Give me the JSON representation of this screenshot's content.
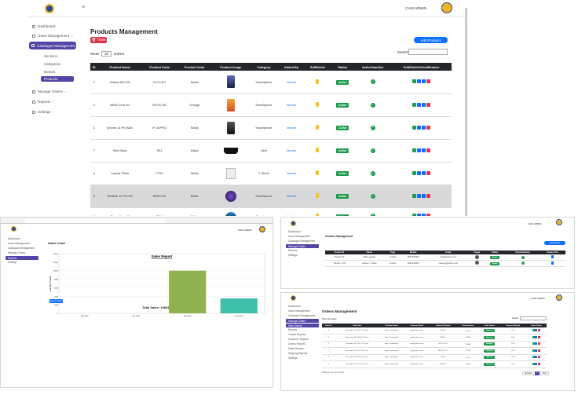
{
  "main": {
    "header": {
      "user_name": "CANI ADMIN",
      "menu_icon": "hamburger-icon"
    },
    "sidebar": {
      "items": [
        {
          "label": "Dashboard",
          "icon": "dashboard-icon"
        },
        {
          "label": "Users Management",
          "icon": "users-icon",
          "caret": "›"
        },
        {
          "label": "Catalogue Management",
          "icon": "catalogue-icon",
          "active": true
        }
      ],
      "sub_items": [
        "Sections",
        "Categories",
        "Brands",
        "Products"
      ],
      "bottom_items": [
        {
          "label": "Manage Orders",
          "caret": "›"
        },
        {
          "label": "Reports",
          "caret": "›"
        },
        {
          "label": "Settings",
          "caret": "›"
        }
      ]
    },
    "page_title": "Products Management",
    "trash_button": "🗑 Trash",
    "add_button": "Add Products",
    "show_label": "Show",
    "show_value": "10",
    "entries_label": "entries",
    "search_label": "Search:",
    "columns": [
      "ID",
      "Product Name",
      "Product Code",
      "Product Color",
      "Product Image",
      "Category",
      "Added By",
      "SoftDelete",
      "Status",
      "Active/Inactive",
      "Edit/Delete/View/Restore"
    ],
    "rows": [
      {
        "id": "1",
        "name": "Galaxy A32 5G",
        "code": "GLXY-5G",
        "color": "Black",
        "category": "Smartphone",
        "added_by": "Vendor",
        "status": "Active",
        "img": "phone-blue"
      },
      {
        "id": "2",
        "name": "Infinix Zero 5G",
        "code": "INFX0-5G",
        "color": "Orange",
        "category": "Smartphone",
        "added_by": "Vendor",
        "status": "Active",
        "img": "phone-orange"
      },
      {
        "id": "3",
        "name": "Iphone 14 Pro Max",
        "code": "IP-14PRO",
        "color": "Black",
        "category": "Smartphone",
        "added_by": "Vendor",
        "status": "Active",
        "img": "phone-black"
      },
      {
        "id": "7",
        "name": "Skirt Black",
        "code": "SK1",
        "color": "Black",
        "category": "Skirt",
        "added_by": "Vendor",
        "status": "Active",
        "img": "skirt"
      },
      {
        "id": "4",
        "name": "Casual TShirt",
        "code": "CTS1",
        "color": "White",
        "category": "T-Shirts",
        "added_by": "Vendor",
        "status": "Active",
        "img": "tshirt"
      },
      {
        "id": "8",
        "name": "Realme 10 Pro 5G",
        "code": "RM10-5G",
        "color": "Black",
        "category": "Smartphone",
        "added_by": "Vendor",
        "status": "Active",
        "img": "phone-round"
      },
      {
        "id": "9",
        "name": "Tecno Nova 5",
        "code": "TF-1",
        "color": "White",
        "category": "Smartphone",
        "added_by": "Vendor",
        "status": "Active",
        "img": "phone-blue2"
      }
    ]
  },
  "sales": {
    "header": {
      "user_name": "CANI ADMIN"
    },
    "sidebar": [
      "Dashboard",
      "Users Management",
      "Catalogue Management",
      "Manage Orders",
      "Reports",
      "Settings"
    ],
    "section_title": "Sales Chart",
    "export_button": "Export Chart",
    "chart_data": {
      "type": "bar",
      "title": "Sales Report",
      "categories": [
        "Feb 2023",
        "Mar 2023",
        "Apr 2023",
        "May 2023"
      ],
      "values": [
        0,
        0,
        10000,
        3500
      ],
      "ylim": [
        0,
        14000
      ],
      "ylabel": "Number of Sales",
      "colors": [
        "#8fb24f",
        "#8fb24f",
        "#8fb24f",
        "#3fc1a9"
      ]
    },
    "total_label": "Total Sales: 19864"
  },
  "vendors": {
    "header": {
      "user_name": "CANI ADMIN"
    },
    "sidebar": [
      "Dashboard",
      "Users Management",
      "Catalogue Management",
      "Manage Orders",
      "Reports",
      "Settings"
    ],
    "title": "Vendors Management",
    "add_button": "Add Vendor",
    "columns": [
      "Vendor ID",
      "Name",
      "Type",
      "Mobile",
      "Email",
      "Image",
      "Status",
      "Active/Inactive",
      "Vendor Info"
    ],
    "rows": [
      {
        "id": "*Vendor-01",
        "name": "Vikri Lagnani",
        "type": "vendor",
        "mobile": "9847493054",
        "email": "vikri@yahoo.com",
        "status": "Active"
      },
      {
        "id": "*Vendor-Y-03",
        "name": "Masum Y Saga",
        "type": "vendor",
        "mobile": "9822345006",
        "email": "masum@yahoo.com",
        "status": "Active"
      }
    ]
  },
  "orders": {
    "header": {
      "user_name": "CANI ADMIN"
    },
    "sidebar": [
      "Dashboard",
      "Users Management",
      "Catalogue Management",
      "Manage Orders",
      "View Orders",
      "Reports",
      "Vendor Reports",
      "Customer Reports",
      "Orders Reports",
      "Sales Reports",
      "Shipping Reports",
      "Settings"
    ],
    "title": "Orders Management",
    "show_label": "Show 10 entries",
    "search_label": "Search:",
    "columns": [
      "Order ID",
      "Order Date",
      "Customer Name",
      "Customer Email",
      "Ordered Products",
      "Order Amount",
      "Order Status",
      "Payment Method",
      "Order Details"
    ],
    "rows": [
      {
        "id": "4",
        "date": "November 24, 2022, 3:00 pm",
        "name": "Ajay S (admitted)",
        "email": "ajay@yahoo.com",
        "products": "TSK1-1",
        "amount": "₹ 5500",
        "status": "Delivered",
        "payment": "COD"
      },
      {
        "id": "5",
        "date": "November 28, 2022, 12:00 pm",
        "name": "Ajay S (admitted)",
        "email": "ajay@yahoo.com",
        "products": "INFX-1",
        "amount": "₹ 4400",
        "status": "Delivered",
        "payment": "COD"
      },
      {
        "id": "6",
        "date": "November 28, 2022, 2:01 pm",
        "name": "Ajay S (admitted)",
        "email": "ajay@yahoo.com",
        "products": "GLXY-1 IP-1",
        "amount": "₹ 9490",
        "status": "Delivered",
        "payment": "COD"
      },
      {
        "id": "7",
        "date": "November 30, 2022, 6:01 pm",
        "name": "Ajay S (admitted)",
        "email": "ajay@yahoo.com",
        "products": "RM10-1 IP-1",
        "amount": "₹ 1730",
        "status": "Delivered",
        "payment": "COD"
      },
      {
        "id": "8",
        "date": "November 30, 2022, 6:22 pm",
        "name": "Ajay S (admitted)",
        "email": "ajay@yahoo.com",
        "products": "TSK1-1",
        "amount": "₹ 1170",
        "status": "Delivered",
        "payment": "COD"
      },
      {
        "id": "9",
        "date": "November 30, 2022, 8:41 pm",
        "name": "Ajay S (admitted)",
        "email": "ajay@yahoo.com",
        "products": "RM10-1",
        "amount": "₹ 5600",
        "status": "Delivered",
        "payment": "COD"
      }
    ],
    "footer": "Showing 1 to 6 of 6 entries",
    "prev_button": "Previous",
    "next_button": "Next",
    "page": "1"
  }
}
